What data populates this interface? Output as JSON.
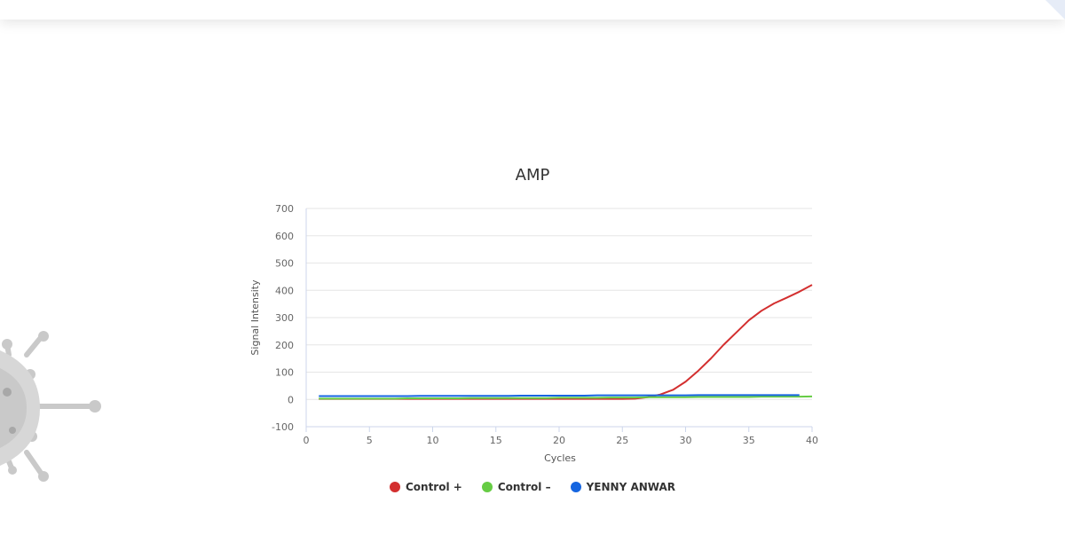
{
  "chart_data": {
    "type": "line",
    "title": "AMP",
    "xlabel": "Cycles",
    "ylabel": "Signal Intensity",
    "xlim": [
      0,
      40
    ],
    "ylim": [
      -100,
      700
    ],
    "xticks": [
      0,
      5,
      10,
      15,
      20,
      25,
      30,
      35,
      40
    ],
    "yticks": [
      -100,
      0,
      100,
      200,
      300,
      400,
      500,
      600,
      700
    ],
    "grid": true,
    "legend_position": "bottom",
    "series": [
      {
        "name": "Control +",
        "color": "#d32f2f",
        "x": [
          1,
          2,
          3,
          4,
          5,
          6,
          7,
          8,
          9,
          10,
          11,
          12,
          13,
          14,
          15,
          16,
          17,
          18,
          19,
          20,
          21,
          22,
          23,
          24,
          25,
          26,
          27,
          28,
          29,
          30,
          31,
          32,
          33,
          34,
          35,
          36,
          37,
          38,
          39,
          40
        ],
        "y": [
          2,
          2,
          2,
          2,
          2,
          2,
          2,
          2,
          2,
          2,
          2,
          2,
          2,
          2,
          2,
          2,
          2,
          2,
          2,
          2,
          2,
          2,
          2,
          2,
          2,
          3,
          8,
          18,
          35,
          65,
          105,
          150,
          200,
          245,
          290,
          325,
          352,
          373,
          395,
          420
        ]
      },
      {
        "name": "Control –",
        "color": "#66cc44",
        "x": [
          1,
          2,
          3,
          4,
          5,
          6,
          7,
          8,
          9,
          10,
          11,
          12,
          13,
          14,
          15,
          16,
          17,
          18,
          19,
          20,
          21,
          22,
          23,
          24,
          25,
          26,
          27,
          28,
          29,
          30,
          31,
          32,
          33,
          34,
          35,
          36,
          37,
          38,
          39,
          40
        ],
        "y": [
          3,
          3,
          3,
          3,
          3,
          3,
          3,
          4,
          4,
          4,
          4,
          4,
          5,
          5,
          5,
          5,
          5,
          5,
          5,
          6,
          6,
          6,
          6,
          7,
          7,
          7,
          8,
          8,
          8,
          8,
          9,
          9,
          9,
          9,
          9,
          10,
          10,
          10,
          10,
          11
        ]
      },
      {
        "name": "YENNY ANWAR",
        "color": "#1565e0",
        "x": [
          1,
          2,
          3,
          4,
          5,
          6,
          7,
          8,
          9,
          10,
          11,
          12,
          13,
          14,
          15,
          16,
          17,
          18,
          19,
          20,
          21,
          22,
          23,
          24,
          25,
          26,
          27,
          28,
          29,
          30,
          31,
          32,
          33,
          34,
          35,
          36,
          37,
          38,
          39
        ],
        "y": [
          12,
          12,
          12,
          12,
          12,
          12,
          12,
          12,
          13,
          13,
          13,
          13,
          13,
          13,
          13,
          13,
          14,
          14,
          14,
          14,
          14,
          14,
          15,
          15,
          15,
          15,
          15,
          15,
          15,
          15,
          16,
          16,
          16,
          16,
          16,
          16,
          16,
          16,
          16
        ]
      }
    ]
  }
}
